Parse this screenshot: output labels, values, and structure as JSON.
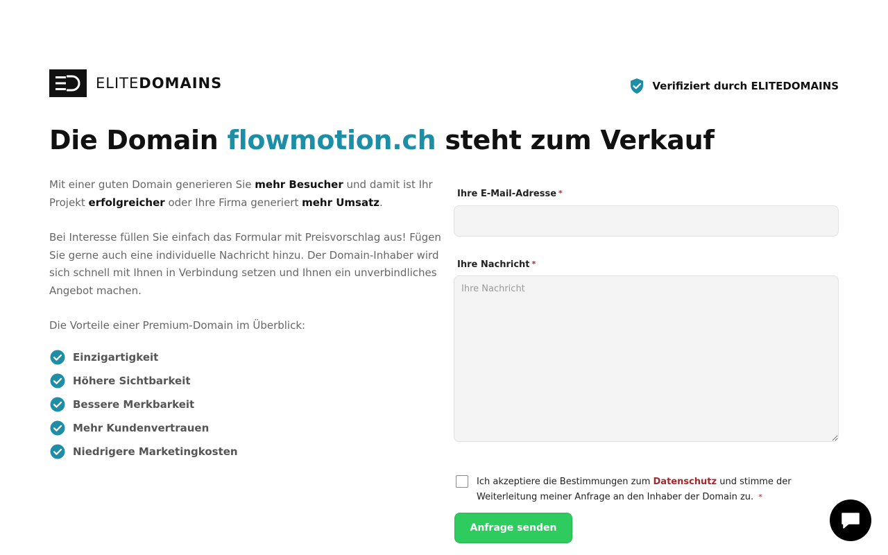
{
  "brand": {
    "mark": "ED",
    "name_light": "ELITE",
    "name_bold": "DOMAINS"
  },
  "header": {
    "verified_text": "Verifiziert durch ELITEDOMAINS"
  },
  "headline": {
    "prefix": "Die Domain ",
    "domain": "flowmotion.ch",
    "suffix": " steht zum Verkauf"
  },
  "intro": {
    "p1": [
      "Mit einer guten Domain generieren Sie ",
      "mehr Besucher",
      " und damit ist Ihr Projekt ",
      "erfolgreicher",
      " oder Ihre Firma generiert ",
      "mehr Umsatz",
      "."
    ],
    "p2": "Bei Interesse füllen Sie einfach das Formular mit Preisvorschlag aus! Fügen Sie gerne auch eine individuelle Nachricht hinzu. Der Domain-Inhaber wird sich schnell mit Ihnen in Verbindung setzen und Ihnen ein unverbindliches Angebot machen.",
    "p3": "Die Vorteile einer Premium-Domain im Überblick:"
  },
  "benefits": [
    "Einzigartigkeit",
    "Höhere Sichtbarkeit",
    "Bessere Merkbarkeit",
    "Mehr Kundenvertrauen",
    "Niedrigere Marketingkosten"
  ],
  "form": {
    "email_label": "Ihre E-Mail-Adresse",
    "email_value": "",
    "message_label": "Ihre Nachricht",
    "message_placeholder": "Ihre Nachricht",
    "required_mark": "*",
    "consent_before": "Ich akzeptiere die Bestimmungen zum ",
    "consent_link": "Datenschutz",
    "consent_after": " und stimme der Weiterleitung meiner Anfrage an den Inhaber der Domain zu.",
    "consent_checked": false,
    "submit_label": "Anfrage senden"
  },
  "colors": {
    "accent": "#1e8ea6",
    "submit": "#2ecc5e",
    "link": "#a4282e",
    "required": "#c0202a"
  },
  "icons": {
    "verified": "shield-check-icon",
    "benefit": "check-circle-icon",
    "chat": "chat-bubble-icon"
  }
}
